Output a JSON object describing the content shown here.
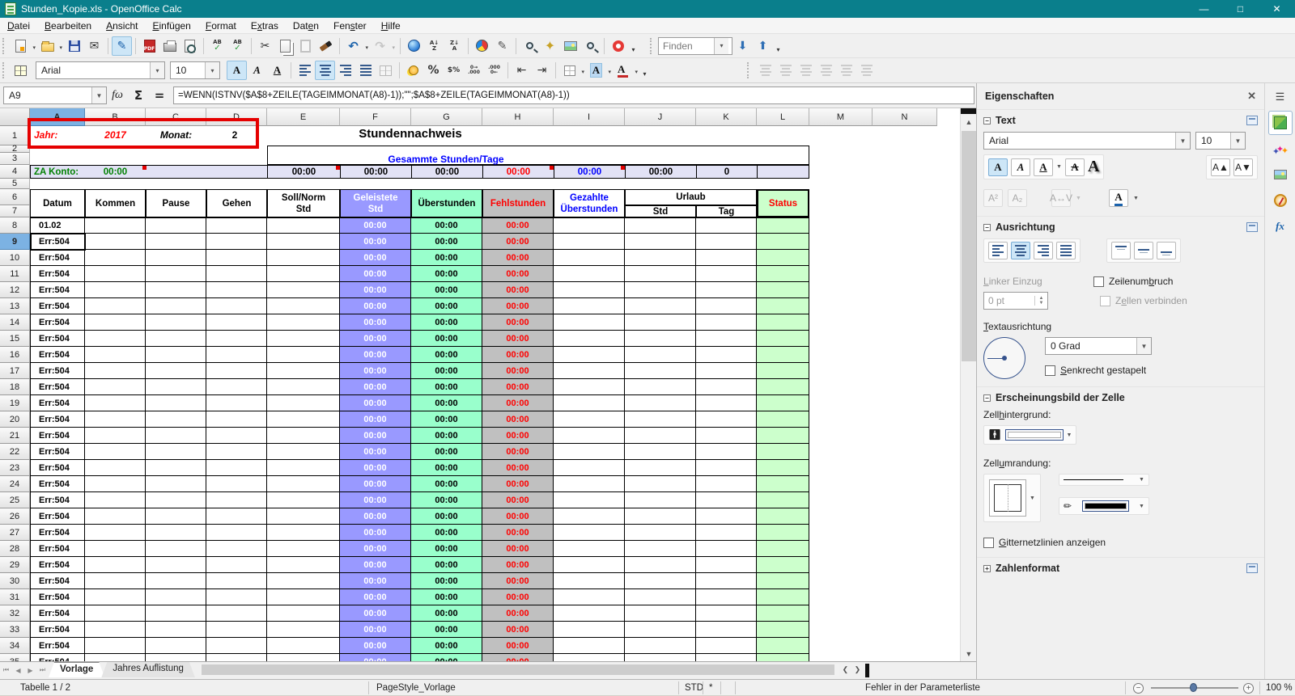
{
  "window": {
    "title": "Stunden_Kopie.xls - OpenOffice Calc"
  },
  "menu": {
    "items": [
      {
        "label": "Datei",
        "accel": 0
      },
      {
        "label": "Bearbeiten",
        "accel": 0
      },
      {
        "label": "Ansicht",
        "accel": 0
      },
      {
        "label": "Einfügen",
        "accel": 0
      },
      {
        "label": "Format",
        "accel": 0
      },
      {
        "label": "Extras",
        "accel": 1
      },
      {
        "label": "Daten",
        "accel": 3
      },
      {
        "label": "Fenster",
        "accel": 3
      },
      {
        "label": "Hilfe",
        "accel": 0
      }
    ]
  },
  "toolbar_standard": {
    "items": [
      {
        "name": "new-document",
        "icon": "new",
        "drop": true
      },
      {
        "name": "open",
        "icon": "folder",
        "drop": true
      },
      {
        "name": "save",
        "icon": "floppy"
      },
      {
        "name": "email",
        "icon": "email"
      },
      {
        "name": "sep"
      },
      {
        "name": "edit-mode",
        "icon": "edit",
        "state": "active"
      },
      {
        "name": "sep"
      },
      {
        "name": "export-pdf",
        "icon": "pdf"
      },
      {
        "name": "print",
        "icon": "printer"
      },
      {
        "name": "page-preview",
        "icon": "preview"
      },
      {
        "name": "sep"
      },
      {
        "name": "spellcheck",
        "icon": "spell"
      },
      {
        "name": "auto-spellcheck",
        "icon": "spell"
      },
      {
        "name": "sep"
      },
      {
        "name": "cut",
        "icon": "cut"
      },
      {
        "name": "copy",
        "icon": "copy"
      },
      {
        "name": "paste",
        "icon": "paste",
        "state": "disabled"
      },
      {
        "name": "format-paintbrush",
        "icon": "brush"
      },
      {
        "name": "sep"
      },
      {
        "name": "undo",
        "icon": "undo",
        "drop": true
      },
      {
        "name": "redo",
        "icon": "redo",
        "drop": true,
        "state": "disabled"
      },
      {
        "name": "sep"
      },
      {
        "name": "hyperlink",
        "icon": "globe"
      },
      {
        "name": "sort-ascending",
        "icon": "sortaz"
      },
      {
        "name": "sort-descending",
        "icon": "sortza"
      },
      {
        "name": "sep"
      },
      {
        "name": "insert-chart",
        "icon": "pie"
      },
      {
        "name": "show-draw-functions",
        "icon": "draw"
      },
      {
        "name": "sep"
      },
      {
        "name": "find-replace",
        "icon": "findrep"
      },
      {
        "name": "navigator",
        "icon": "nav"
      },
      {
        "name": "gallery",
        "icon": "gallery"
      },
      {
        "name": "zoom",
        "icon": "zoomer"
      },
      {
        "name": "sep"
      },
      {
        "name": "help",
        "icon": "help"
      },
      {
        "name": "overflow"
      }
    ],
    "find": {
      "placeholder": "Finden",
      "buttons": [
        {
          "name": "find-next",
          "icon": "finddown"
        },
        {
          "name": "find-previous",
          "icon": "findup"
        },
        {
          "name": "overflow"
        }
      ]
    }
  },
  "toolbar_formatting": {
    "font_name": "Arial",
    "font_size": "10",
    "items": [
      {
        "name": "sidebar-grid",
        "icon": "grid4"
      },
      {
        "name": "font-name-combo"
      },
      {
        "name": "font-size-combo"
      },
      {
        "name": "bold",
        "icon": "boldA",
        "state": "active"
      },
      {
        "name": "italic",
        "icon": "italicA"
      },
      {
        "name": "underline",
        "icon": "underA"
      },
      {
        "name": "sep"
      },
      {
        "name": "align-left",
        "icon": "alleft"
      },
      {
        "name": "align-center",
        "icon": "alcenter",
        "state": "active"
      },
      {
        "name": "align-right",
        "icon": "alright"
      },
      {
        "name": "align-justify",
        "icon": "aljust"
      },
      {
        "name": "merge-cells",
        "icon": "merge",
        "state": "disabled"
      },
      {
        "name": "sep"
      },
      {
        "name": "number-format-currency",
        "icon": "coin"
      },
      {
        "name": "number-format-percent",
        "icon": "percent"
      },
      {
        "name": "number-format-standard",
        "icon": "stdfmt"
      },
      {
        "name": "add-decimal-place",
        "icon": "adddec"
      },
      {
        "name": "delete-decimal-place",
        "icon": "deldec"
      },
      {
        "name": "sep"
      },
      {
        "name": "decrease-indent",
        "icon": "indentm"
      },
      {
        "name": "increase-indent",
        "icon": "indentp"
      },
      {
        "name": "sep"
      },
      {
        "name": "borders",
        "icon": "borders",
        "drop": true
      },
      {
        "name": "background-color",
        "icon": "bgcol",
        "drop": true
      },
      {
        "name": "font-color",
        "icon": "fontcol",
        "drop": true
      },
      {
        "name": "overflow"
      }
    ],
    "align_extra": [
      "align-left-obj",
      "center-horizontal-obj",
      "align-right-obj",
      "align-top-obj",
      "center-vertical-obj",
      "align-bottom-obj"
    ]
  },
  "formula_bar": {
    "name_box": "A9",
    "formula": "=WENN(ISTNV($A$8+ZEILE(TAGEIMMONAT(A8)-1));\"\";$A$8+ZEILE(TAGEIMMONAT(A8)-1))"
  },
  "sheet": {
    "column_headers": [
      "A",
      "B",
      "C",
      "D",
      "E",
      "F",
      "G",
      "H",
      "I",
      "J",
      "K",
      "L",
      "M",
      "N"
    ],
    "selected_column": "A",
    "selected_row": 9,
    "row1": {
      "jahr_label": "Jahr:",
      "jahr_value": "2017",
      "monat_label": "Monat:",
      "monat_value": "2"
    },
    "title": "Stundennachweis",
    "band_header": "Gesammte Stunden/Tage",
    "row4": {
      "label": "ZA Konto:",
      "konto_value": "00:00",
      "values": {
        "E": "00:00",
        "F": "00:00",
        "G": "00:00",
        "H": "00:00",
        "I": "00:00",
        "J": "00:00",
        "K": "0"
      },
      "value_colors": {
        "E": "#000000",
        "F": "#000000",
        "G": "#000000",
        "H": "#ff0000",
        "I": "#0000ff",
        "J": "#000000",
        "K": "#000000"
      }
    },
    "table_columns": [
      {
        "label": "Datum"
      },
      {
        "label": "Kommen"
      },
      {
        "label": "Pause"
      },
      {
        "label": "Gehen"
      },
      {
        "label": "Soll/Norm",
        "label2": "Std"
      },
      {
        "label": "Geleistete",
        "label2": "Std"
      },
      {
        "label": "Überstunden"
      },
      {
        "label": "Fehlstunden"
      },
      {
        "label": "Gezahlte",
        "label2": "Überstunden"
      },
      {
        "label": "Urlaub",
        "sub": [
          "Std",
          "Tag"
        ]
      },
      {
        "label": "Status"
      }
    ],
    "first_row_value": "01.02",
    "error_value": "Err:504",
    "row_times": {
      "geleistete": "00:00",
      "ueberstunden": "00:00",
      "fehlstunden": "00:00"
    },
    "colors": {
      "geleistete_bg": "#9999ff",
      "ueberstunden_bg": "#99ffcc",
      "fehlstunden_bg": "#c0c0c0",
      "status_bg": "#ccffcc",
      "band_bg": "#e2e2f5",
      "fehl_text": "#ff0000",
      "blue_text": "#0000ff",
      "green_text": "#008000",
      "red_text": "#ff0000"
    }
  },
  "sidebar": {
    "title": "Eigenschaften",
    "text_section": {
      "label": "Text",
      "font_name": "Arial",
      "font_size": "10"
    },
    "ausrichtung": {
      "label": "Ausrichtung",
      "linker_einzug": {
        "label": "Linker Einzug",
        "accel": 0,
        "value": "0 pt"
      },
      "zeilenumbruch": {
        "label": "Zeilenumbruch",
        "accel": 8
      },
      "zellen_verbinden": {
        "label": "Zellen verbinden",
        "accel": 1
      },
      "textausrichtung": {
        "label": "Textausrichtung",
        "accel": 0
      },
      "grad_value": "0 Grad",
      "senkrecht": {
        "label": "Senkrecht gestapelt",
        "accel": 0
      }
    },
    "erscheinung": {
      "label": "Erscheinungsbild der Zelle",
      "zellhintergrund": {
        "label": "Zellhintergrund:",
        "accel": 4
      },
      "zellumrandung": {
        "label": "Zellumrandung:",
        "accel": 4
      },
      "gitter": {
        "label": "Gitternetzlinien anzeigen",
        "accel": 0
      }
    },
    "zahlenformat": {
      "label": "Zahlenformat"
    },
    "tabs": [
      "properties",
      "styles",
      "gallery",
      "navigator",
      "functions"
    ]
  },
  "tabbar": {
    "tabs": [
      "Vorlage",
      "Jahres Auflistung"
    ]
  },
  "statusbar": {
    "sheet_info": "Tabelle 1 / 2",
    "page_style": "PageStyle_Vorlage",
    "selection_mode": "STD",
    "modified": "*",
    "message": "Fehler in der Parameterliste",
    "zoom": "100 %"
  }
}
